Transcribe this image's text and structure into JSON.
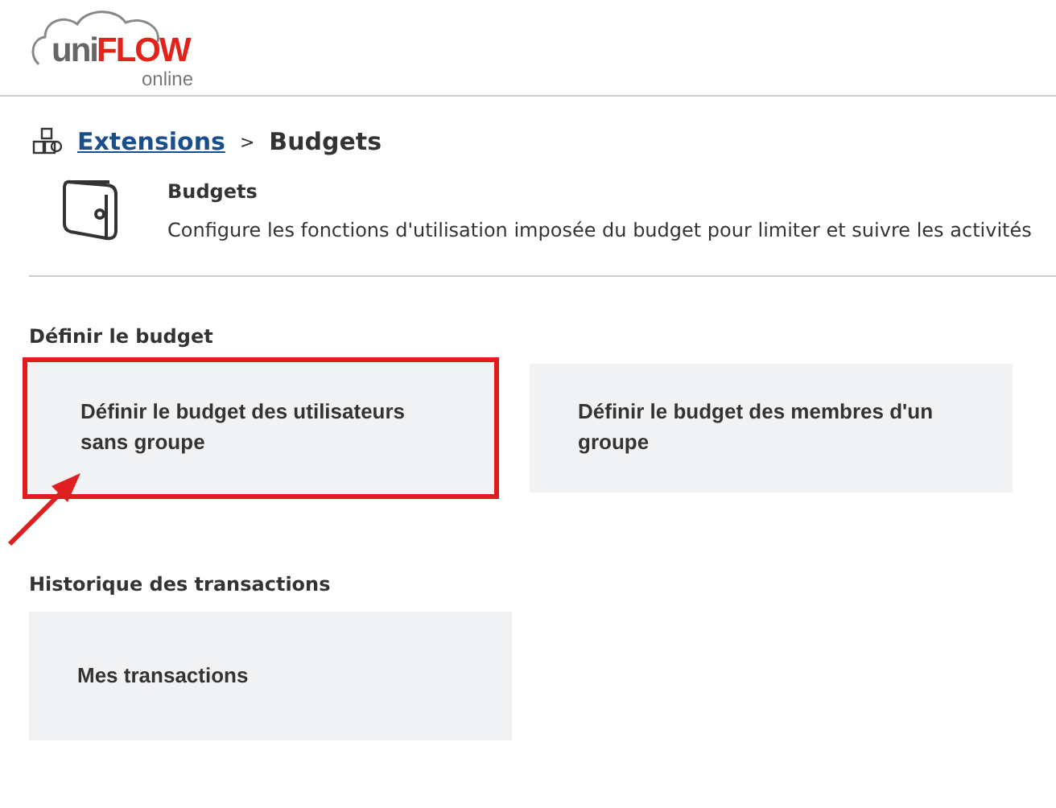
{
  "logo": {
    "brand_light": "uni",
    "brand_bold": "FLOW",
    "subtitle": "online"
  },
  "breadcrumb": {
    "link": "Extensions",
    "separator": ">",
    "current": "Budgets"
  },
  "header": {
    "title": "Budgets",
    "description": "Configure les fonctions d'utilisation imposée du budget pour limiter et suivre les activités"
  },
  "sections": [
    {
      "title": "Définir le budget",
      "tiles": [
        {
          "label": "Définir le budget des utilisateurs sans groupe",
          "highlighted": true
        },
        {
          "label": "Définir le budget des membres d'un groupe",
          "highlighted": false
        }
      ]
    },
    {
      "title": "Historique des transactions",
      "tiles": [
        {
          "label": "Mes transactions",
          "highlighted": false
        }
      ]
    }
  ]
}
